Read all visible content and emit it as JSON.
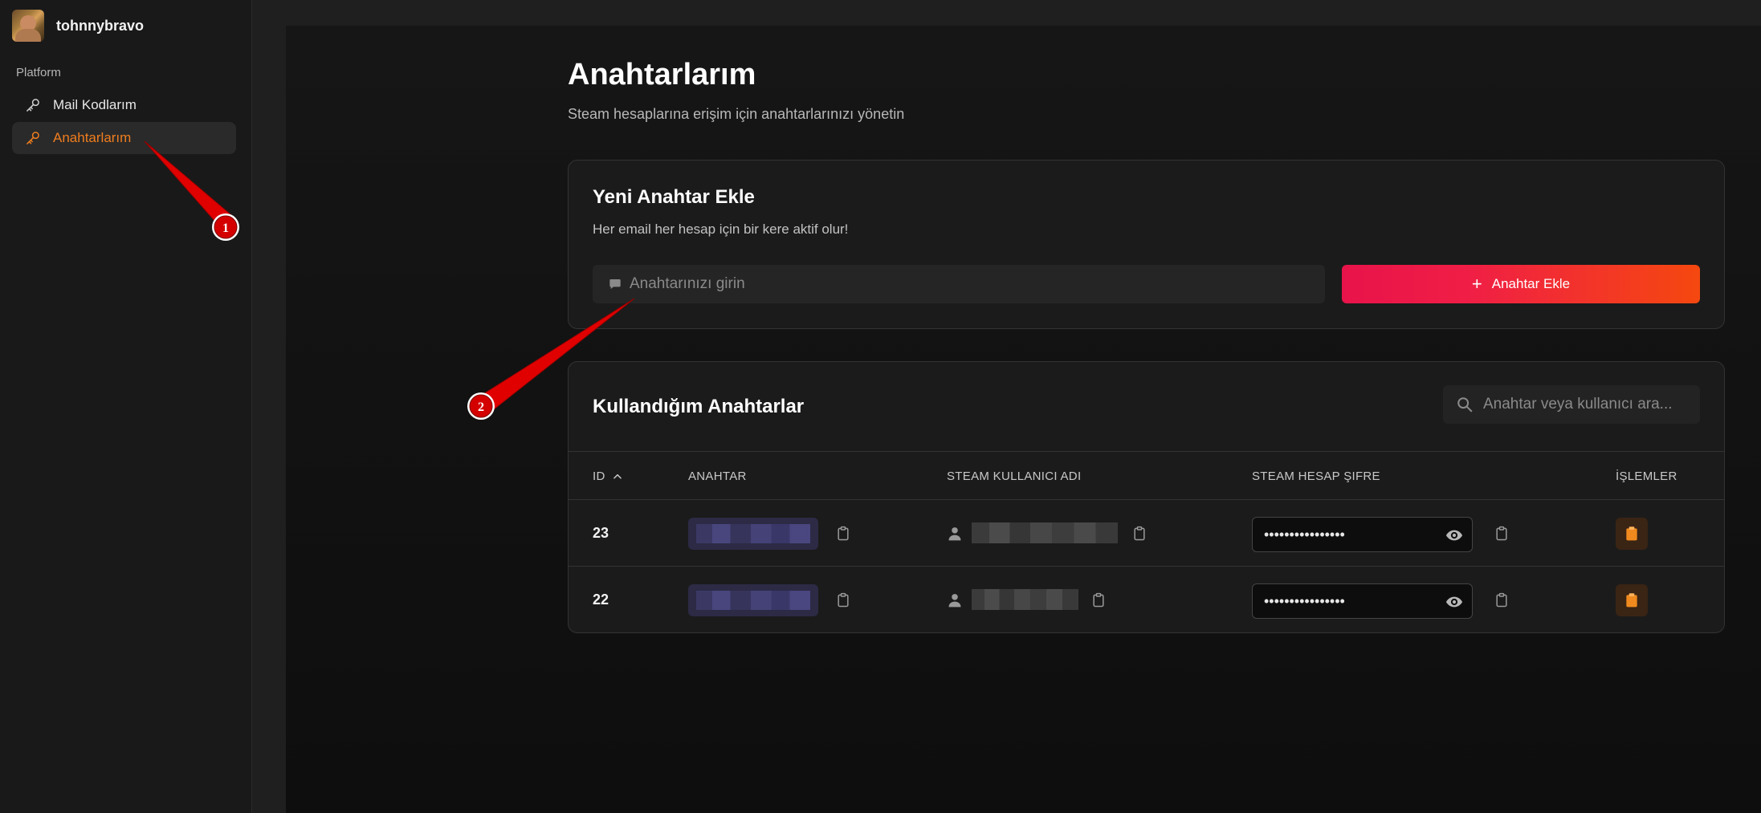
{
  "user": {
    "name": "tohnnybravo"
  },
  "sidebar": {
    "section_label": "Platform",
    "items": [
      {
        "label": "Mail Kodlarım",
        "icon": "key-icon",
        "active": false
      },
      {
        "label": "Anahtarlarım",
        "icon": "key-icon",
        "active": true
      }
    ]
  },
  "page": {
    "title": "Anahtarlarım",
    "subtitle": "Steam hesaplarına erişim için anahtarlarınızı yönetin"
  },
  "add_card": {
    "title": "Yeni Anahtar Ekle",
    "description": "Her email her hesap için bir kere aktif olur!",
    "input_placeholder": "Anahtarınızı girin",
    "button_label": "Anahtar Ekle"
  },
  "table_card": {
    "title": "Kullandığım Anahtarlar",
    "search_placeholder": "Anahtar veya kullanıcı ara...",
    "columns": [
      "ID",
      "ANAHTAR",
      "STEAM KULLANICI ADI",
      "STEAM HESAP ŞIFRE",
      "İŞLEMLER"
    ],
    "rows": [
      {
        "id": "23",
        "password_mask": "••••••••••••••••"
      },
      {
        "id": "22",
        "password_mask": "••••••••••••••••"
      }
    ]
  },
  "annotations": [
    "1",
    "2"
  ],
  "colors": {
    "accent_orange": "#f07d1e",
    "button_gradient_start": "#e8134a",
    "button_gradient_end": "#f5480f",
    "annotation_red": "#e00000"
  }
}
